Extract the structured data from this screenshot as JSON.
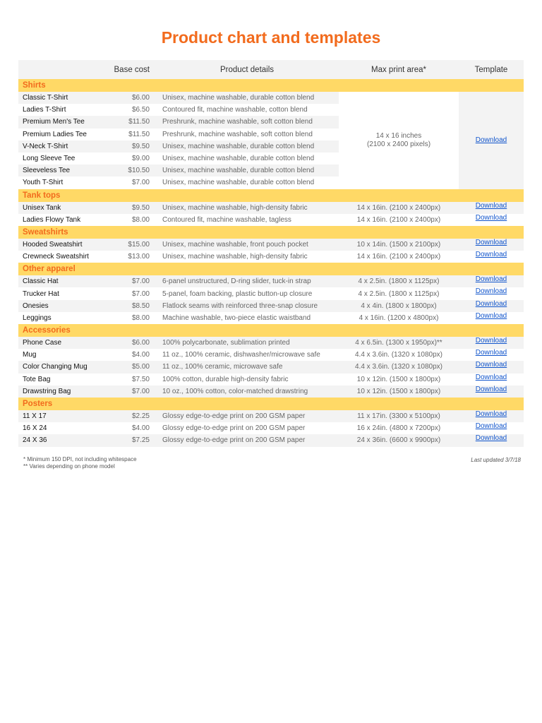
{
  "title": "Product chart and templates",
  "headers": {
    "name": "",
    "cost": "Base cost",
    "details": "Product details",
    "print": "Max print area*",
    "template": "Template"
  },
  "sections": [
    {
      "label": "Shirts",
      "merged_print": [
        "14 x 16 inches",
        "(2100 x 2400 pixels)"
      ],
      "merged_template": "Download",
      "items": [
        {
          "name": "Classic T-Shirt",
          "cost": "$6.00",
          "details": "Unisex, machine washable, durable cotton blend"
        },
        {
          "name": "Ladies T-Shirt",
          "cost": "$6.50",
          "details": "Contoured fit, machine washable, cotton blend"
        },
        {
          "name": "Premium Men's Tee",
          "cost": "$11.50",
          "details": "Preshrunk, machine washable, soft cotton blend"
        },
        {
          "name": "Premium Ladies Tee",
          "cost": "$11.50",
          "details": "Preshrunk, machine washable, soft cotton blend"
        },
        {
          "name": "V-Neck T-Shirt",
          "cost": "$9.50",
          "details": "Unisex, machine washable, durable cotton blend"
        },
        {
          "name": "Long Sleeve Tee",
          "cost": "$9.00",
          "details": "Unisex, machine washable, durable cotton blend"
        },
        {
          "name": "Sleeveless Tee",
          "cost": "$10.50",
          "details": "Unisex, machine washable, durable cotton blend"
        },
        {
          "name": "Youth T-Shirt",
          "cost": "$7.00",
          "details": "Unisex, machine washable, durable cotton blend"
        }
      ]
    },
    {
      "label": "Tank tops",
      "items": [
        {
          "name": "Unisex Tank",
          "cost": "$9.50",
          "details": "Unisex, machine washable, high-density fabric",
          "print": "14 x 16in. (2100 x 2400px)",
          "template": "Download"
        },
        {
          "name": "Ladies Flowy Tank",
          "cost": "$8.00",
          "details": "Contoured fit, machine washable, tagless",
          "print": "14 x 16in. (2100 x 2400px)",
          "template": "Download"
        }
      ]
    },
    {
      "label": "Sweatshirts",
      "items": [
        {
          "name": "Hooded Sweatshirt",
          "cost": "$15.00",
          "details": "Unisex, machine washable, front pouch pocket",
          "print": "10 x 14in. (1500 x 2100px)",
          "template": "Download"
        },
        {
          "name": "Crewneck Sweatshirt",
          "cost": "$13.00",
          "details": "Unisex, machine washable, high-density fabric",
          "print": "14 x 16in. (2100 x 2400px)",
          "template": "Download"
        }
      ]
    },
    {
      "label": "Other apparel",
      "items": [
        {
          "name": "Classic Hat",
          "cost": "$7.00",
          "details": "6-panel unstructured, D-ring slider, tuck-in strap",
          "print": "4 x 2.5in. (1800 x 1125px)",
          "template": "Download"
        },
        {
          "name": "Trucker Hat",
          "cost": "$7.00",
          "details": "5-panel, foam backing, plastic button-up closure",
          "print": "4 x 2.5in. (1800 x 1125px)",
          "template": "Download"
        },
        {
          "name": "Onesies",
          "cost": "$8.50",
          "details": "Flatlock seams with reinforced three-snap closure",
          "print": "4 x 4in. (1800 x 1800px)",
          "template": "Download"
        },
        {
          "name": "Leggings",
          "cost": "$8.00",
          "details": "Machine washable, two-piece elastic waistband",
          "print": "4 x 16in. (1200 x 4800px)",
          "template": "Download"
        }
      ]
    },
    {
      "label": "Accessories",
      "items": [
        {
          "name": "Phone Case",
          "cost": "$6.00",
          "details": "100% polycarbonate, sublimation printed",
          "print": "4 x 6.5in. (1300 x 1950px)**",
          "template": "Download"
        },
        {
          "name": "Mug",
          "cost": "$4.00",
          "details": "11 oz., 100% ceramic, dishwasher/microwave safe",
          "print": "4.4 x 3.6in. (1320 x 1080px)",
          "template": "Download"
        },
        {
          "name": "Color Changing Mug",
          "cost": "$5.00",
          "details": "11 oz., 100% ceramic, microwave safe",
          "print": "4.4 x 3.6in. (1320 x 1080px)",
          "template": "Download"
        },
        {
          "name": "Tote Bag",
          "cost": "$7.50",
          "details": "100% cotton, durable high-density fabric",
          "print": "10 x 12in. (1500 x 1800px)",
          "template": "Download"
        },
        {
          "name": "Drawstring Bag",
          "cost": "$7.00",
          "details": "10 oz., 100% cotton, color-matched drawstring",
          "print": "10 x 12in. (1500 x 1800px)",
          "template": "Download"
        }
      ]
    },
    {
      "label": "Posters",
      "items": [
        {
          "name": "11 X 17",
          "cost": "$2.25",
          "details": "Glossy edge-to-edge print on 200 GSM paper",
          "print": "11 x 17in. (3300 x 5100px)",
          "template": "Download"
        },
        {
          "name": "16 X 24",
          "cost": "$4.00",
          "details": "Glossy edge-to-edge print on 200 GSM paper",
          "print": "16 x 24in. (4800 x 7200px)",
          "template": "Download"
        },
        {
          "name": "24 X 36",
          "cost": "$7.25",
          "details": "Glossy edge-to-edge print on 200 GSM paper",
          "print": "24 x 36in. (6600 x 9900px)",
          "template": "Download"
        }
      ]
    }
  ],
  "footnotes": [
    "* Minimum 150 DPI, not including whitespace",
    "** Varies depending on phone model"
  ],
  "last_updated": "Last updated 3/7/18",
  "colors": {
    "accent": "#f26b1d",
    "section_bg": "#ffd966",
    "row_alt": "#f3f3f3",
    "link": "#1155cc"
  }
}
